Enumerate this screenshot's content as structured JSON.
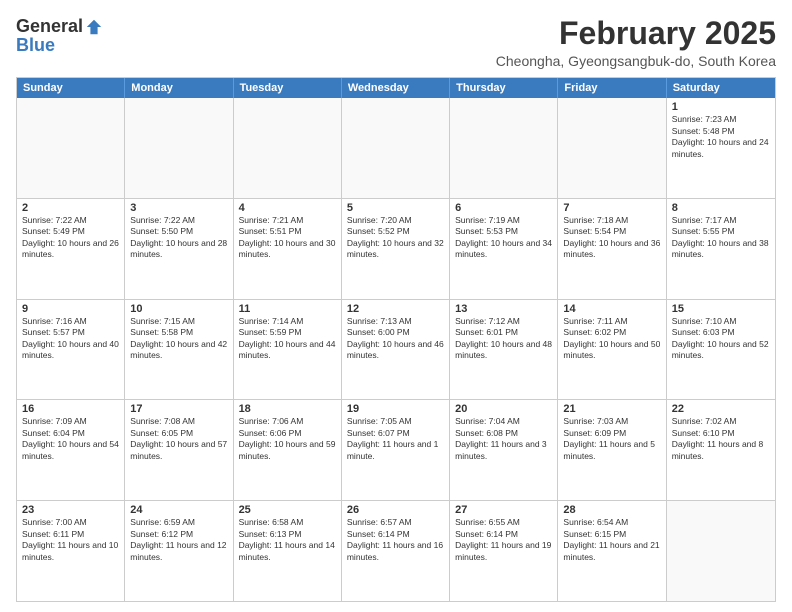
{
  "logo": {
    "general": "General",
    "blue": "Blue"
  },
  "title": "February 2025",
  "location": "Cheongha, Gyeongsangbuk-do, South Korea",
  "headers": [
    "Sunday",
    "Monday",
    "Tuesday",
    "Wednesday",
    "Thursday",
    "Friday",
    "Saturday"
  ],
  "weeks": [
    [
      {
        "day": "",
        "info": ""
      },
      {
        "day": "",
        "info": ""
      },
      {
        "day": "",
        "info": ""
      },
      {
        "day": "",
        "info": ""
      },
      {
        "day": "",
        "info": ""
      },
      {
        "day": "",
        "info": ""
      },
      {
        "day": "1",
        "info": "Sunrise: 7:23 AM\nSunset: 5:48 PM\nDaylight: 10 hours and 24 minutes."
      }
    ],
    [
      {
        "day": "2",
        "info": "Sunrise: 7:22 AM\nSunset: 5:49 PM\nDaylight: 10 hours and 26 minutes."
      },
      {
        "day": "3",
        "info": "Sunrise: 7:22 AM\nSunset: 5:50 PM\nDaylight: 10 hours and 28 minutes."
      },
      {
        "day": "4",
        "info": "Sunrise: 7:21 AM\nSunset: 5:51 PM\nDaylight: 10 hours and 30 minutes."
      },
      {
        "day": "5",
        "info": "Sunrise: 7:20 AM\nSunset: 5:52 PM\nDaylight: 10 hours and 32 minutes."
      },
      {
        "day": "6",
        "info": "Sunrise: 7:19 AM\nSunset: 5:53 PM\nDaylight: 10 hours and 34 minutes."
      },
      {
        "day": "7",
        "info": "Sunrise: 7:18 AM\nSunset: 5:54 PM\nDaylight: 10 hours and 36 minutes."
      },
      {
        "day": "8",
        "info": "Sunrise: 7:17 AM\nSunset: 5:55 PM\nDaylight: 10 hours and 38 minutes."
      }
    ],
    [
      {
        "day": "9",
        "info": "Sunrise: 7:16 AM\nSunset: 5:57 PM\nDaylight: 10 hours and 40 minutes."
      },
      {
        "day": "10",
        "info": "Sunrise: 7:15 AM\nSunset: 5:58 PM\nDaylight: 10 hours and 42 minutes."
      },
      {
        "day": "11",
        "info": "Sunrise: 7:14 AM\nSunset: 5:59 PM\nDaylight: 10 hours and 44 minutes."
      },
      {
        "day": "12",
        "info": "Sunrise: 7:13 AM\nSunset: 6:00 PM\nDaylight: 10 hours and 46 minutes."
      },
      {
        "day": "13",
        "info": "Sunrise: 7:12 AM\nSunset: 6:01 PM\nDaylight: 10 hours and 48 minutes."
      },
      {
        "day": "14",
        "info": "Sunrise: 7:11 AM\nSunset: 6:02 PM\nDaylight: 10 hours and 50 minutes."
      },
      {
        "day": "15",
        "info": "Sunrise: 7:10 AM\nSunset: 6:03 PM\nDaylight: 10 hours and 52 minutes."
      }
    ],
    [
      {
        "day": "16",
        "info": "Sunrise: 7:09 AM\nSunset: 6:04 PM\nDaylight: 10 hours and 54 minutes."
      },
      {
        "day": "17",
        "info": "Sunrise: 7:08 AM\nSunset: 6:05 PM\nDaylight: 10 hours and 57 minutes."
      },
      {
        "day": "18",
        "info": "Sunrise: 7:06 AM\nSunset: 6:06 PM\nDaylight: 10 hours and 59 minutes."
      },
      {
        "day": "19",
        "info": "Sunrise: 7:05 AM\nSunset: 6:07 PM\nDaylight: 11 hours and 1 minute."
      },
      {
        "day": "20",
        "info": "Sunrise: 7:04 AM\nSunset: 6:08 PM\nDaylight: 11 hours and 3 minutes."
      },
      {
        "day": "21",
        "info": "Sunrise: 7:03 AM\nSunset: 6:09 PM\nDaylight: 11 hours and 5 minutes."
      },
      {
        "day": "22",
        "info": "Sunrise: 7:02 AM\nSunset: 6:10 PM\nDaylight: 11 hours and 8 minutes."
      }
    ],
    [
      {
        "day": "23",
        "info": "Sunrise: 7:00 AM\nSunset: 6:11 PM\nDaylight: 11 hours and 10 minutes."
      },
      {
        "day": "24",
        "info": "Sunrise: 6:59 AM\nSunset: 6:12 PM\nDaylight: 11 hours and 12 minutes."
      },
      {
        "day": "25",
        "info": "Sunrise: 6:58 AM\nSunset: 6:13 PM\nDaylight: 11 hours and 14 minutes."
      },
      {
        "day": "26",
        "info": "Sunrise: 6:57 AM\nSunset: 6:14 PM\nDaylight: 11 hours and 16 minutes."
      },
      {
        "day": "27",
        "info": "Sunrise: 6:55 AM\nSunset: 6:14 PM\nDaylight: 11 hours and 19 minutes."
      },
      {
        "day": "28",
        "info": "Sunrise: 6:54 AM\nSunset: 6:15 PM\nDaylight: 11 hours and 21 minutes."
      },
      {
        "day": "",
        "info": ""
      }
    ]
  ]
}
